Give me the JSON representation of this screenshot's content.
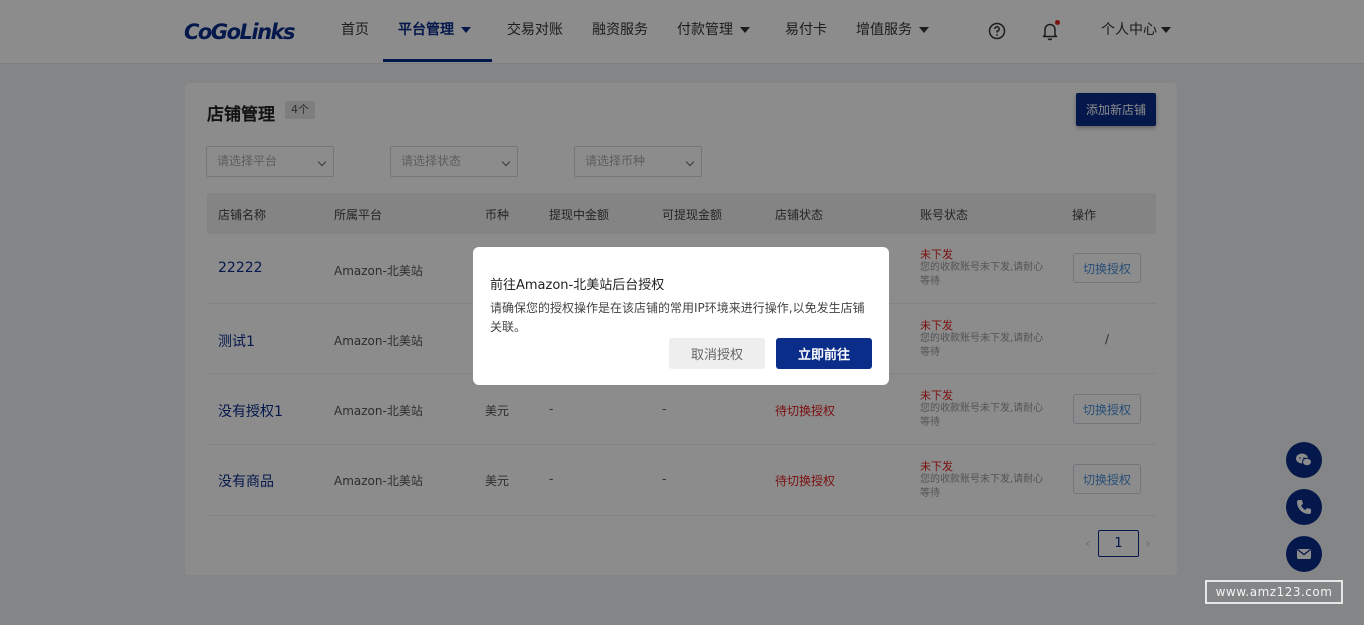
{
  "header": {
    "logo_text": "CoGoLinks",
    "nav": [
      {
        "label": "首页",
        "dropdown": false,
        "active": false
      },
      {
        "label": "平台管理",
        "dropdown": true,
        "active": true
      },
      {
        "label": "交易对账",
        "dropdown": false,
        "active": false
      },
      {
        "label": "融资服务",
        "dropdown": false,
        "active": false
      },
      {
        "label": "付款管理",
        "dropdown": true,
        "active": false
      },
      {
        "label": "易付卡",
        "dropdown": false,
        "active": false
      },
      {
        "label": "增值服务",
        "dropdown": true,
        "active": false
      }
    ],
    "help_icon": "question-circle-icon",
    "bell_icon": "bell-icon",
    "user_menu_label": "个人中心",
    "accent_color": "#0a2d8a"
  },
  "page": {
    "title": "店铺管理",
    "count_badge": "4个",
    "add_button_label": "添加新店铺"
  },
  "filters": [
    {
      "placeholder": "请选择平台"
    },
    {
      "placeholder": "请选择状态"
    },
    {
      "placeholder": "请选择币种"
    }
  ],
  "table": {
    "columns": [
      "店铺名称",
      "所属平台",
      "币种",
      "提现中金额",
      "可提现金额",
      "店铺状态",
      "账号状态",
      "操作"
    ],
    "rows": [
      {
        "name": "22222",
        "platform": "Amazon-北美站",
        "currency": "",
        "withdrawing": "",
        "withdrawable": "",
        "store_status": "",
        "account_status": "未下发",
        "account_desc": "您的收款账号未下发,请耐心等待",
        "action": "切换授权"
      },
      {
        "name": "测试1",
        "platform": "Amazon-北美站",
        "currency": "",
        "withdrawing": "",
        "withdrawable": "",
        "store_status": "",
        "account_status": "未下发",
        "account_desc": "您的收款账号未下发,请耐心等待",
        "action": "/"
      },
      {
        "name": "没有授权1",
        "platform": "Amazon-北美站",
        "currency": "美元",
        "withdrawing": "-",
        "withdrawable": "-",
        "store_status": "待切换授权",
        "account_status": "未下发",
        "account_desc": "您的收款账号未下发,请耐心等待",
        "action": "切换授权"
      },
      {
        "name": "没有商品",
        "platform": "Amazon-北美站",
        "currency": "美元",
        "withdrawing": "-",
        "withdrawable": "-",
        "store_status": "待切换授权",
        "account_status": "未下发",
        "account_desc": "您的收款账号未下发,请耐心等待",
        "action": "切换授权"
      }
    ]
  },
  "pagination": {
    "current_page": "1"
  },
  "float_buttons": [
    "wechat-icon",
    "phone-icon",
    "mail-icon"
  ],
  "dialog": {
    "title": "前往Amazon-北美站后台授权",
    "body": "请确保您的授权操作是在该店铺的常用IP环境来进行操作,以免发生店铺关联。",
    "cancel_label": "取消授权",
    "confirm_label": "立即前往"
  },
  "watermark": "www.amz123.com"
}
